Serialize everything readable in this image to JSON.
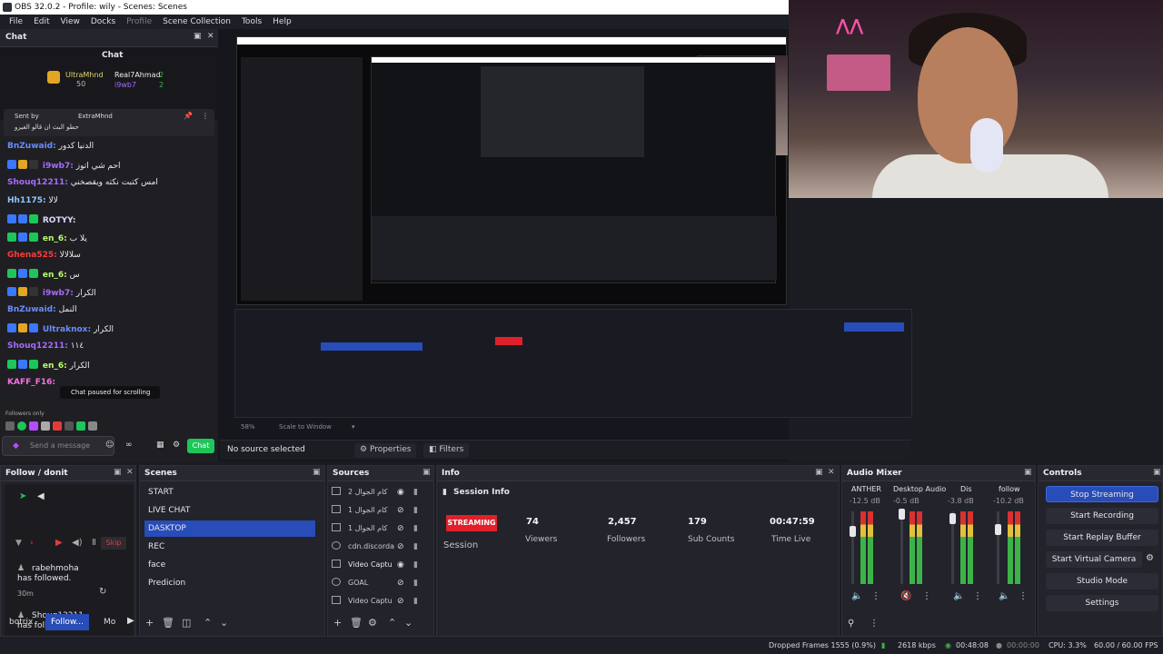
{
  "window": {
    "title": "OBS 32.0.2 - Profile: wily - Scenes: Scenes"
  },
  "menu": [
    "File",
    "Edit",
    "View",
    "Docks",
    "Profile",
    "Scene Collection",
    "Tools",
    "Help"
  ],
  "chat_dock": {
    "title": "Chat",
    "header_title": "Chat",
    "top_gifters": [
      {
        "name": "UltraMhnd",
        "count": "50"
      },
      {
        "name": "Real7Ahmad",
        "count": "2"
      },
      {
        "name": "i9wb7",
        "count": "2"
      }
    ],
    "pinned": {
      "label": "Sent by",
      "user": "ExtraMhnd",
      "message": "حطو البث ان قالو الغيرو"
    },
    "lines": [
      {
        "user": "BnZuwaid:",
        "msg": "الدنيا كدور",
        "color": "#6b8bff"
      },
      {
        "user": "i9wb7:",
        "msg": "احم شي اتوز",
        "color": "#a66bff"
      },
      {
        "user": "Shouq12211:",
        "msg": "امس كتبت نكته ويقصخني",
        "color": "#a66bff"
      },
      {
        "user": "Hh1175:",
        "msg": "لالا",
        "color": "#8ec6ff"
      },
      {
        "user": "ROTYY:",
        "msg": "",
        "color": "#d9d9ff"
      },
      {
        "user": "en_6:",
        "msg": "يلا ب",
        "color": "#b8ff6b"
      },
      {
        "user": "Ghena525:",
        "msg": "سلالالا",
        "color": "#ff3b3b"
      },
      {
        "user": "en_6:",
        "msg": "س",
        "color": "#b8ff6b"
      },
      {
        "user": "i9wb7:",
        "msg": "الكرار",
        "color": "#a66bff"
      },
      {
        "user": "BnZuwaid:",
        "msg": "النمل",
        "color": "#6b8bff"
      },
      {
        "user": "Ultraknox:",
        "msg": "الكرار",
        "color": "#6b8bff"
      },
      {
        "user": "Shouq12211:",
        "msg": "١١٤",
        "color": "#a66bff"
      },
      {
        "user": "en_6:",
        "msg": "الكرار",
        "color": "#b8ff6b"
      },
      {
        "user": "KAFF_F16:",
        "msg": "",
        "color": "#ff6be8"
      }
    ],
    "paused_notice": "Chat paused for scrolling",
    "followers_only": "Followers only",
    "input_placeholder": "Send a message",
    "send_label": "Chat"
  },
  "preview": {
    "no_source": "No source selected",
    "properties_label": "Properties",
    "filters_label": "Filters",
    "scale_label": "Scale to Window",
    "zoom": "58%"
  },
  "follow_dock": {
    "title": "Follow / donit",
    "skip": "Skip",
    "events": [
      {
        "name": "rabehmoha",
        "text": "has followed.",
        "time": "30m"
      },
      {
        "name": "Shouq12211",
        "text": "has followed.",
        "time": ""
      }
    ],
    "tabs": [
      "botrix",
      "Follow...",
      "Mo"
    ]
  },
  "scenes_dock": {
    "title": "Scenes",
    "items": [
      "START",
      "LIVE CHAT",
      "DASKTOP",
      "REC",
      "face",
      "Predicion"
    ],
    "selected": "DASKTOP"
  },
  "sources_dock": {
    "title": "Sources",
    "items": [
      "2 كام الجوال",
      "1 كام الجوال",
      "1 كام الجوال",
      "cdn.discorda",
      "Video Captu",
      "GOAL",
      "Video Captu"
    ]
  },
  "info_dock": {
    "title": "Info",
    "session_title": "Session Info",
    "status": "STREAMING",
    "status_label": "Session",
    "stats": [
      {
        "value": "74",
        "label": "Viewers"
      },
      {
        "value": "2,457",
        "label": "Followers"
      },
      {
        "value": "179",
        "label": "Sub Counts"
      },
      {
        "value": "00:47:59",
        "label": "Time Live"
      }
    ],
    "status_color": "#e0202a"
  },
  "audio_mixer": {
    "title": "Audio Mixer",
    "channels": [
      {
        "name": "ANTHER",
        "db": "-12.5 dB",
        "level": 0.72
      },
      {
        "name": "Desktop Audio",
        "db": "-0.5 dB",
        "level": 0.96
      },
      {
        "name": "Dis",
        "db": "-3.8 dB",
        "level": 0.9
      },
      {
        "name": "follow",
        "db": "-10.2 dB",
        "level": 0.75
      }
    ]
  },
  "controls": {
    "title": "Controls",
    "buttons": [
      "Stop Streaming",
      "Start Recording",
      "Start Replay Buffer",
      "Start Virtual Camera",
      "Studio Mode",
      "Settings"
    ],
    "active": "Stop Streaming",
    "accent": "#284cb8"
  },
  "status": {
    "dropped": "Dropped Frames 1555 (0.9%)",
    "bitrate": "2618 kbps",
    "stream_time": "00:48:08",
    "rec_time": "00:00:00",
    "cpu": "CPU: 3.3%",
    "fps": "60.00 / 60.00 FPS"
  }
}
